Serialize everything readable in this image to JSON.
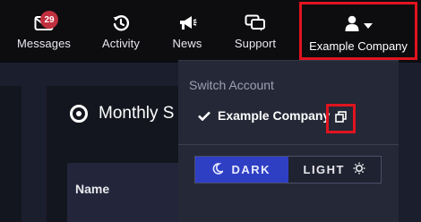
{
  "nav": {
    "messages": {
      "label": "Messages",
      "badge": "29",
      "icon": "envelope-icon"
    },
    "activity": {
      "label": "Activity",
      "icon": "history-icon"
    },
    "news": {
      "label": "News",
      "icon": "megaphone-icon"
    },
    "support": {
      "label": "Support",
      "icon": "chat-bubbles-icon"
    },
    "account": {
      "label": "Example Company",
      "icon": "user-icon"
    }
  },
  "main": {
    "title": "Monthly S",
    "table": {
      "header_name": "Name"
    }
  },
  "dropdown": {
    "header": "Switch Account",
    "current_account": "Example Company",
    "theme": {
      "dark_label": "DARK",
      "light_label": "LIGHT",
      "selected": "dark"
    }
  },
  "colors": {
    "background": "#0d0d10",
    "dropdown_bg": "#252836",
    "highlight_outline": "#e0141f",
    "badge": "#c0303f",
    "dark_active": "#2f3fc4"
  }
}
